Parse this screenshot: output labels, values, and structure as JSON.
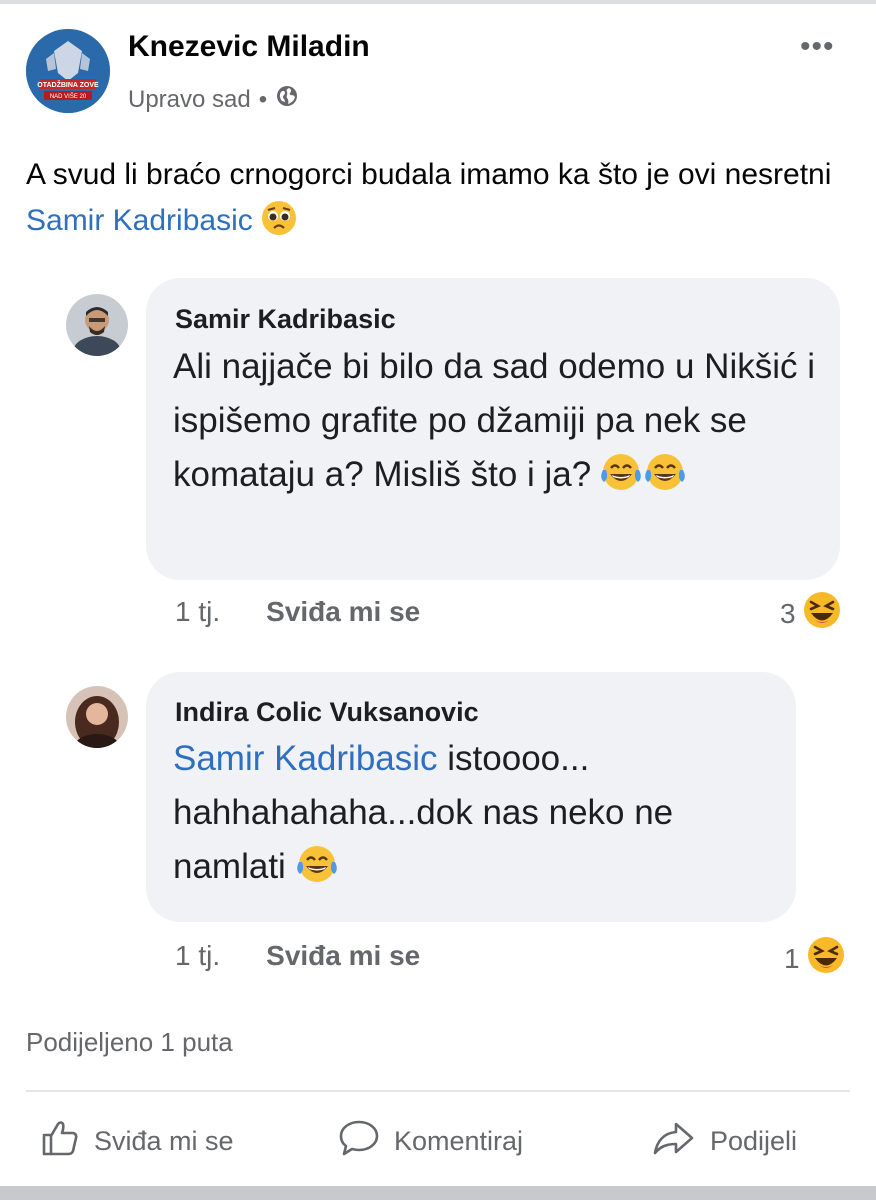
{
  "post": {
    "author": "Knezevic Miladin",
    "time": "Upravo sad",
    "separator": "•",
    "privacy_icon": "globe-icon",
    "more_label": "•••",
    "text_before": "A svud li braćo crnogorci budala imamo ka što je ovi nesretni ",
    "mention": "Samir Kadribasic",
    "emoji_icon": "pleading-face-icon",
    "avatar_text_top": "OTADŽBINA ZOVE",
    "avatar_text_bottom": "NAD VIŠE 20"
  },
  "comments": [
    {
      "author": "Samir Kadribasic",
      "text": "Ali najjače bi bilo da sad odemo u Nikšić i ispišemo grafite po džamiji pa nek se komataju a? Misliš što i ja?",
      "emojis": [
        "tears-of-joy-icon",
        "tears-of-joy-icon"
      ],
      "age": "1 tj.",
      "like_label": "Sviđa mi se",
      "reaction_count": "3",
      "reaction_icon": "laughing-face-icon"
    },
    {
      "author": "Indira Colic Vuksanovic",
      "mention": "Samir Kadribasic",
      "text": " istoooo... hahhahahaha...dok nas neko ne namlati",
      "emojis": [
        "tears-of-joy-icon"
      ],
      "age": "1 tj.",
      "like_label": "Sviđa mi se",
      "reaction_count": "1",
      "reaction_icon": "laughing-face-icon"
    }
  ],
  "shared": "Podijeljeno 1 puta",
  "actions": {
    "like": "Sviđa mi se",
    "comment": "Komentiraj",
    "share": "Podijeli"
  },
  "colors": {
    "link": "#2f6fbf",
    "bubble": "#f0f2f5",
    "secondary_text": "#65676b"
  }
}
